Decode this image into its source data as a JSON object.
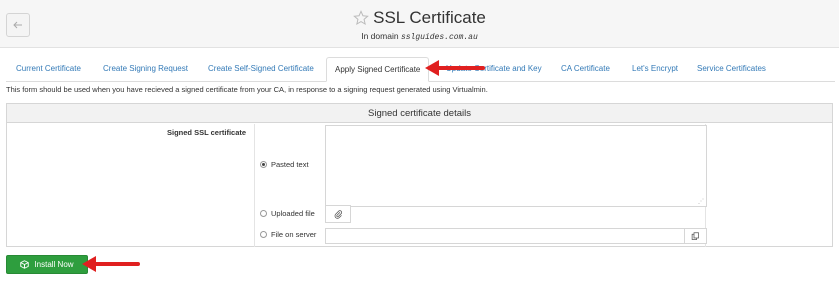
{
  "header": {
    "title": "SSL Certificate",
    "subtitle_prefix": "In domain",
    "domain": "sslguides.com.au"
  },
  "tabs": [
    {
      "label": "Current Certificate"
    },
    {
      "label": "Create Signing Request"
    },
    {
      "label": "Create Self-Signed Certificate"
    },
    {
      "label": "Apply Signed Certificate",
      "active": true
    },
    {
      "label": "Update Certificate and Key"
    },
    {
      "label": "CA Certificate"
    },
    {
      "label": "Let's Encrypt"
    },
    {
      "label": "Service Certificates"
    }
  ],
  "description": "This form should be used when you have recieved a signed certificate from your CA, in response to a signing request generated using Virtualmin.",
  "form": {
    "heading": "Signed certificate details",
    "field_label": "Signed SSL certificate",
    "options": {
      "pasted": "Pasted text",
      "uploaded": "Uploaded file",
      "server": "File on server"
    },
    "selected_option": "pasted"
  },
  "actions": {
    "install_label": "Install Now"
  },
  "colors": {
    "link": "#337ab7",
    "install_button": "#2e9e3e",
    "annotation_arrow": "#e02020"
  },
  "icons": [
    "back-arrow-icon",
    "star-icon",
    "paperclip-icon",
    "file-browse-icon",
    "install-icon"
  ]
}
